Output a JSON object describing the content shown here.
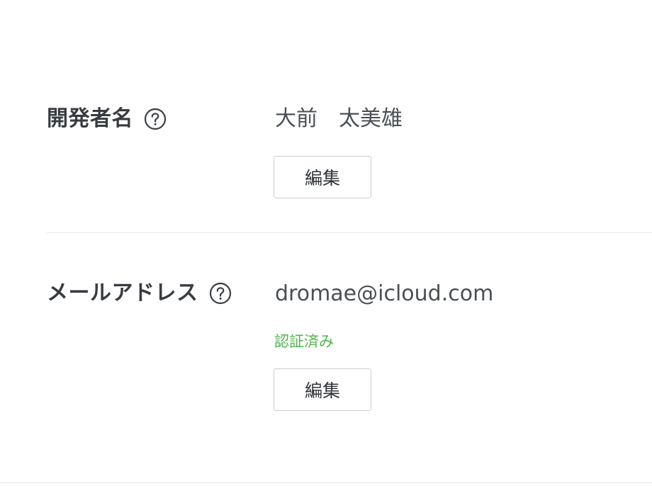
{
  "developer_name": {
    "label": "開発者名",
    "help_icon": "question-circle-icon",
    "value": "大前　太美雄",
    "edit_label": "編集"
  },
  "email": {
    "label": "メールアドレス",
    "help_icon": "question-circle-icon",
    "value": "dromae@icloud.com",
    "status": "認証済み",
    "status_color": "#4fb34a",
    "edit_label": "編集"
  },
  "colors": {
    "text": "#3a3f45",
    "divider": "#e6e8eb",
    "button_border": "#c9cdd2"
  }
}
